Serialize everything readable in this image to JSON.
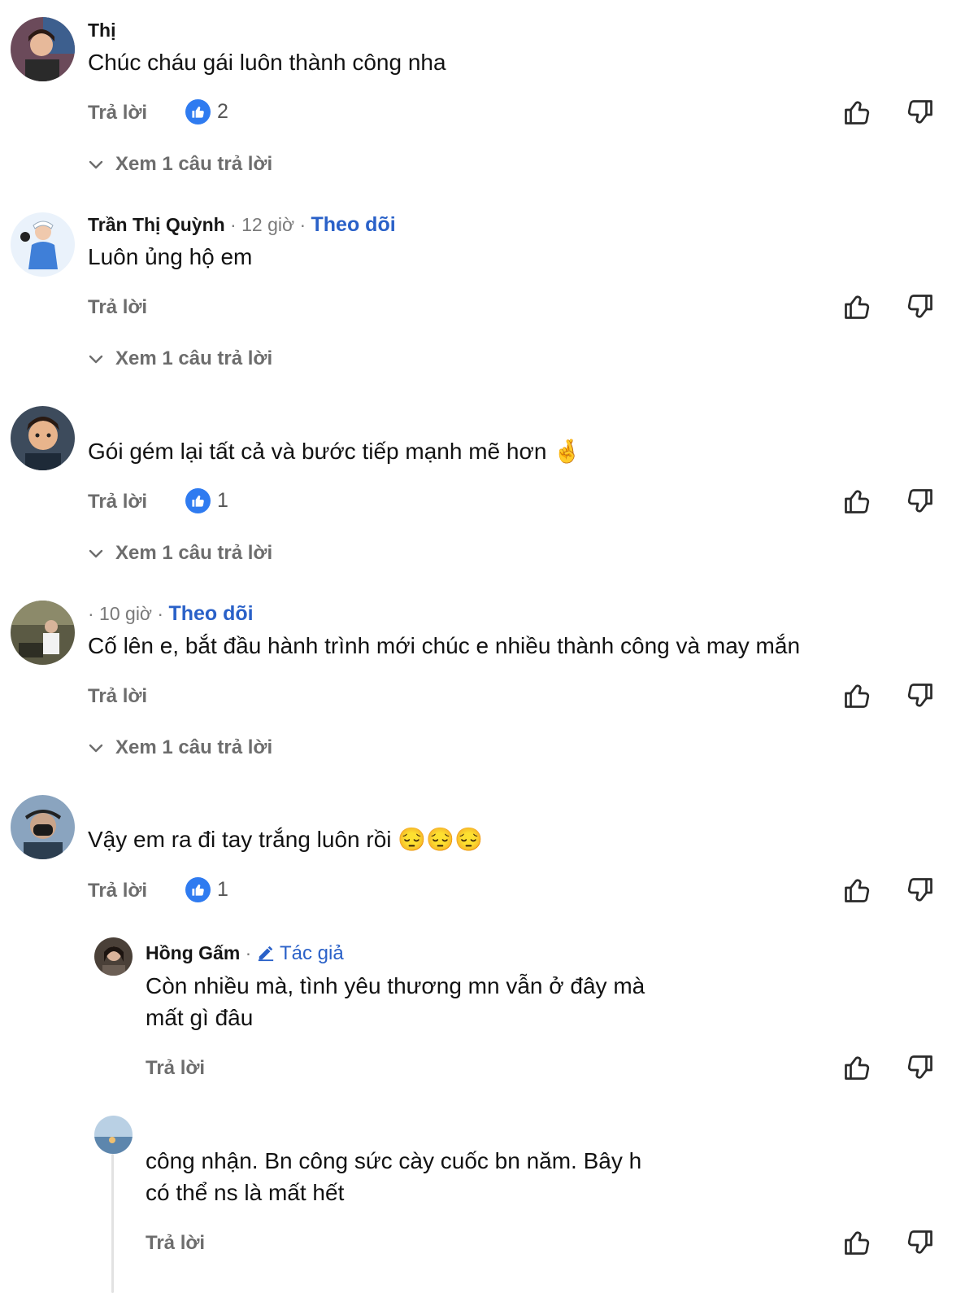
{
  "comments": [
    {
      "name": "Thị",
      "meta": "",
      "follow": "",
      "text": "Chúc cháu gái luôn thành công nha",
      "reply": "Trả lời",
      "likes": "2",
      "more": "Xem 1 câu trả lời"
    },
    {
      "name": "Trần Thị Quỳnh",
      "meta": " · 12 giờ · ",
      "follow": "Theo dõi",
      "text": "Luôn ủng hộ em",
      "reply": "Trả lời",
      "likes": "",
      "more": "Xem 1 câu trả lời"
    },
    {
      "name": "",
      "meta": "",
      "follow": "",
      "text": "Gói gém lại tất cả và bước tiếp mạnh mẽ hơn",
      "emoji": "🤞",
      "reply": "Trả lời",
      "likes": "1",
      "more": "Xem 1 câu trả lời"
    },
    {
      "name": "",
      "meta": " · 10 giờ · ",
      "follow": "Theo dõi",
      "text": "Cố lên e, bắt đầu hành trình mới chúc e nhiều thành công và may mắn",
      "reply": "Trả lời",
      "likes": "",
      "more": "Xem 1 câu trả lời"
    },
    {
      "name": "",
      "meta": "",
      "follow": "",
      "text": "Vậy em ra đi tay trắng luôn rồi",
      "emoji": "😔😔😔",
      "reply": "Trả lời",
      "likes": "1"
    }
  ],
  "replies": [
    {
      "name": "Hồng Gấm",
      "meta": " · ",
      "author": "Tác giả",
      "mention": "",
      "text_line1": "Còn nhiều mà, tình yêu thương mn vẫn ở đây mà",
      "text_line2": "mất gì đâu",
      "reply": "Trả lời"
    },
    {
      "name": "",
      "meta": "",
      "mention": "",
      "text_line1": "công nhận. Bn công sức cày cuốc bn năm. Bây h",
      "text_line2": "có thể ns là mất hết",
      "reply": "Trả lời"
    }
  ],
  "colors": {
    "link": "#2a61c8",
    "like_badge": "#2f7bf0",
    "muted": "#6d6d6d"
  },
  "icons": {
    "like": "thumbs-up-icon",
    "dislike": "thumbs-down-icon",
    "badge": "like-badge-icon",
    "chevron": "chevron-down-icon",
    "author": "pencil-icon"
  }
}
